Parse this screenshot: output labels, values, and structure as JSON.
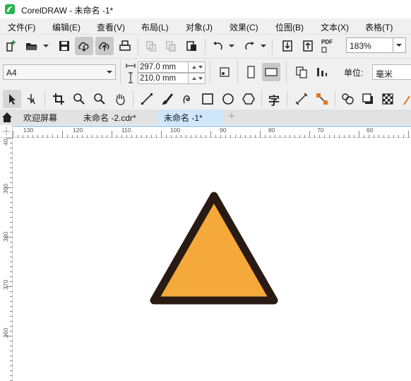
{
  "window": {
    "title": "CorelDRAW - 未命名 -1*"
  },
  "menu": {
    "items": [
      {
        "label": "文件(F)"
      },
      {
        "label": "编辑(E)"
      },
      {
        "label": "查看(V)"
      },
      {
        "label": "布局(L)"
      },
      {
        "label": "对象(J)"
      },
      {
        "label": "效果(C)"
      },
      {
        "label": "位图(B)"
      },
      {
        "label": "文本(X)"
      },
      {
        "label": "表格(T)"
      }
    ]
  },
  "toolbar": {
    "zoom_value": "183%",
    "pdf_label": "PDF",
    "icons": [
      "new-document-icon",
      "open-folder-icon",
      "save-icon",
      "cloud-download-icon",
      "cloud-upload-icon",
      "print-icon",
      "cut-icon",
      "copy-icon",
      "paste-icon",
      "undo-icon",
      "redo-icon",
      "import-icon",
      "export-icon",
      "publish-pdf-icon"
    ]
  },
  "property_bar": {
    "page_size": "A4",
    "width": "297.0 mm",
    "height": "210.0 mm",
    "unit_label": "单位:",
    "unit_value": "毫米"
  },
  "toolbox": {
    "text_tool_glyph": "字",
    "icons": [
      "pick-tool-icon",
      "shape-tool-icon",
      "crop-tool-icon",
      "zoom-tool-icon",
      "zoom-tool-alt-icon",
      "pan-tool-icon",
      "freehand-tool-icon",
      "artistic-media-icon",
      "spiral-icon",
      "rectangle-tool-icon",
      "ellipse-tool-icon",
      "polygon-tool-icon",
      "text-tool-icon",
      "parallel-dimension-icon",
      "connector-icon",
      "blend-tool-icon",
      "drop-shadow-icon",
      "transparency-icon"
    ]
  },
  "tabs": [
    {
      "label": "欢迎屏幕"
    },
    {
      "label": "未命名 -2.cdr*"
    },
    {
      "label": "未命名 -1*"
    }
  ],
  "rulers": {
    "top_labels": [
      "130",
      "120",
      "110",
      "100",
      "90",
      "80",
      "70",
      "60"
    ],
    "left_labels": [
      "40",
      "390",
      "380",
      "370",
      "360"
    ]
  },
  "canvas": {
    "shape": "triangle",
    "fill_color": "#f5a93a",
    "stroke_color": "#2a1a14"
  },
  "colors": {
    "chrome": "#f0f0f0",
    "active_tab": "#cfe6fb",
    "logo_green": "#27b34b"
  }
}
